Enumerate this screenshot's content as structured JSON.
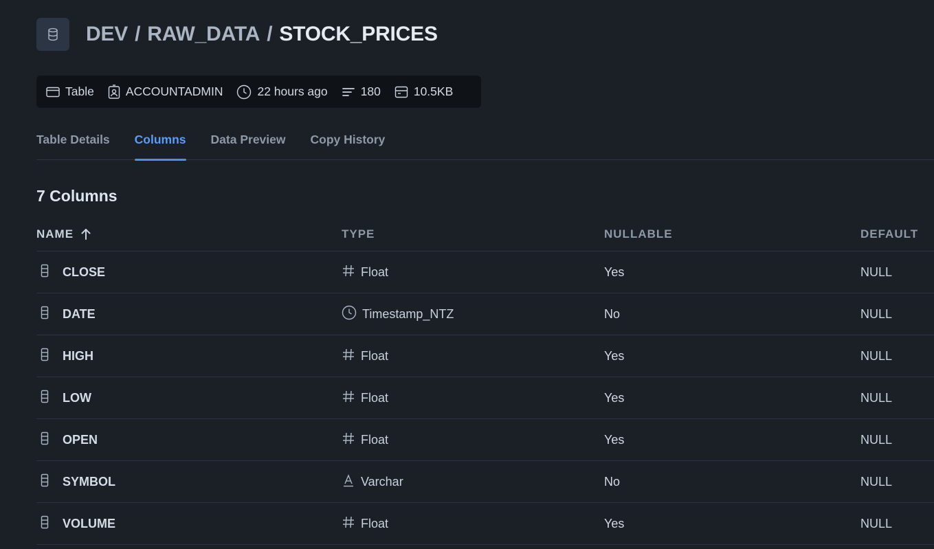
{
  "breadcrumb": {
    "database": "DEV",
    "schema": "RAW_DATA",
    "table": "STOCK_PRICES",
    "separator": "/"
  },
  "meta": {
    "kind": "Table",
    "owner": "ACCOUNTADMIN",
    "updated": "22 hours ago",
    "rows": "180",
    "size": "10.5KB"
  },
  "tabs": [
    {
      "label": "Table Details",
      "active": false
    },
    {
      "label": "Columns",
      "active": true
    },
    {
      "label": "Data Preview",
      "active": false
    },
    {
      "label": "Copy History",
      "active": false
    }
  ],
  "columns_count": "7 Columns",
  "table": {
    "headers": {
      "name": "NAME",
      "type": "TYPE",
      "nullable": "NULLABLE",
      "default": "DEFAULT"
    },
    "sort_icon": "arrow-up-icon",
    "rows": [
      {
        "name": "CLOSE",
        "type": "Float",
        "type_icon": "hash-icon",
        "nullable": "Yes",
        "default": "NULL"
      },
      {
        "name": "DATE",
        "type": "Timestamp_NTZ",
        "type_icon": "clock-icon",
        "nullable": "No",
        "default": "NULL"
      },
      {
        "name": "HIGH",
        "type": "Float",
        "type_icon": "hash-icon",
        "nullable": "Yes",
        "default": "NULL"
      },
      {
        "name": "LOW",
        "type": "Float",
        "type_icon": "hash-icon",
        "nullable": "Yes",
        "default": "NULL"
      },
      {
        "name": "OPEN",
        "type": "Float",
        "type_icon": "hash-icon",
        "nullable": "Yes",
        "default": "NULL"
      },
      {
        "name": "SYMBOL",
        "type": "Varchar",
        "type_icon": "text-icon",
        "nullable": "No",
        "default": "NULL"
      },
      {
        "name": "VOLUME",
        "type": "Float",
        "type_icon": "hash-icon",
        "nullable": "Yes",
        "default": "NULL"
      }
    ]
  },
  "colors": {
    "background": "#1b1f26",
    "accent": "#4b8ef0",
    "meta_bar": "#0f1318"
  }
}
